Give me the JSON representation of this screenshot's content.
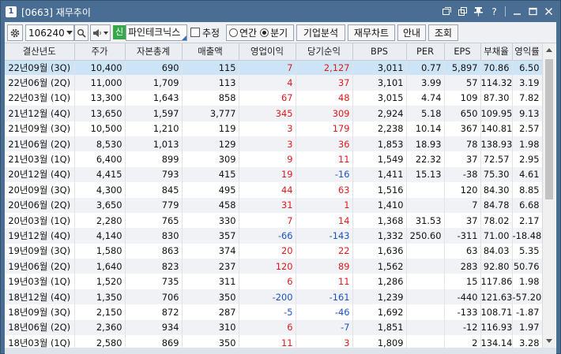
{
  "window": {
    "number": "1",
    "title": "[0663] 재무추이"
  },
  "titlebar_icons": [
    "restore-icon",
    "copy-icon",
    "pin-icon",
    "help-icon",
    "minimize-icon",
    "maximize-icon",
    "close-icon"
  ],
  "toolbar": {
    "stock_code": "106240",
    "new_badge": "신",
    "company_name": "파인테크닉스",
    "estimate_label": "추정",
    "estimate_checked": false,
    "period_options": [
      "연간",
      "분기"
    ],
    "period_selected": "분기",
    "buttons": [
      "기업분석",
      "재무차트",
      "안내",
      "조회"
    ]
  },
  "table": {
    "columns": [
      "결산년도",
      "주가",
      "자본총계",
      "매출액",
      "영업이익",
      "당기순익",
      "BPS",
      "PER",
      "EPS",
      "부채율",
      "영익률"
    ],
    "rows": [
      {
        "period": "22년09월 (3Q)",
        "price": "10,400",
        "equity": "690",
        "sales": "115",
        "op": "7",
        "net": "2,127",
        "bps": "3,011",
        "per": "0.77",
        "eps": "5,897",
        "debt": "70.86",
        "opm": "6.50",
        "op_c": "red",
        "net_c": "red"
      },
      {
        "period": "22년06월 (2Q)",
        "price": "11,000",
        "equity": "1,709",
        "sales": "113",
        "op": "4",
        "net": "37",
        "bps": "3,101",
        "per": "3.99",
        "eps": "57",
        "debt": "114.32",
        "opm": "3.19",
        "op_c": "red",
        "net_c": "red"
      },
      {
        "period": "22년03월 (1Q)",
        "price": "13,300",
        "equity": "1,643",
        "sales": "858",
        "op": "67",
        "net": "48",
        "bps": "3,015",
        "per": "4.74",
        "eps": "109",
        "debt": "87.30",
        "opm": "7.82",
        "op_c": "red",
        "net_c": "red"
      },
      {
        "period": "21년12월 (4Q)",
        "price": "13,650",
        "equity": "1,597",
        "sales": "3,777",
        "op": "345",
        "net": "309",
        "bps": "2,924",
        "per": "5.18",
        "eps": "650",
        "debt": "109.95",
        "opm": "9.13",
        "op_c": "red",
        "net_c": "red"
      },
      {
        "period": "21년09월 (3Q)",
        "price": "10,500",
        "equity": "1,210",
        "sales": "119",
        "op": "3",
        "net": "179",
        "bps": "2,238",
        "per": "10.14",
        "eps": "367",
        "debt": "140.81",
        "opm": "2.57",
        "op_c": "red",
        "net_c": "red"
      },
      {
        "period": "21년06월 (2Q)",
        "price": "8,530",
        "equity": "1,013",
        "sales": "129",
        "op": "3",
        "net": "36",
        "bps": "1,853",
        "per": "18.93",
        "eps": "78",
        "debt": "138.93",
        "opm": "1.98",
        "op_c": "red",
        "net_c": "red"
      },
      {
        "period": "21년03월 (1Q)",
        "price": "6,400",
        "equity": "899",
        "sales": "309",
        "op": "9",
        "net": "11",
        "bps": "1,549",
        "per": "22.32",
        "eps": "37",
        "debt": "72.57",
        "opm": "2.95",
        "op_c": "red",
        "net_c": "red"
      },
      {
        "period": "20년12월 (4Q)",
        "price": "4,415",
        "equity": "793",
        "sales": "415",
        "op": "19",
        "net": "-16",
        "bps": "1,411",
        "per": "15.13",
        "eps": "-38",
        "debt": "75.30",
        "opm": "4.61",
        "op_c": "red",
        "net_c": "blue"
      },
      {
        "period": "20년09월 (3Q)",
        "price": "4,300",
        "equity": "845",
        "sales": "495",
        "op": "44",
        "net": "63",
        "bps": "1,516",
        "per": "",
        "eps": "120",
        "debt": "84.30",
        "opm": "8.85",
        "op_c": "red",
        "net_c": "red"
      },
      {
        "period": "20년06월 (2Q)",
        "price": "3,650",
        "equity": "779",
        "sales": "458",
        "op": "31",
        "net": "1",
        "bps": "1,410",
        "per": "",
        "eps": "7",
        "debt": "84.78",
        "opm": "6.68",
        "op_c": "red",
        "net_c": "red"
      },
      {
        "period": "20년03월 (1Q)",
        "price": "2,280",
        "equity": "765",
        "sales": "330",
        "op": "7",
        "net": "14",
        "bps": "1,368",
        "per": "31.53",
        "eps": "37",
        "debt": "78.02",
        "opm": "2.17",
        "op_c": "red",
        "net_c": "red"
      },
      {
        "period": "19년12월 (4Q)",
        "price": "4,140",
        "equity": "830",
        "sales": "357",
        "op": "-66",
        "net": "-143",
        "bps": "1,332",
        "per": "250.60",
        "eps": "-311",
        "debt": "71.00",
        "opm": "-18.48",
        "op_c": "blue",
        "net_c": "blue"
      },
      {
        "period": "19년09월 (3Q)",
        "price": "1,580",
        "equity": "863",
        "sales": "374",
        "op": "20",
        "net": "22",
        "bps": "1,636",
        "per": "",
        "eps": "63",
        "debt": "84.03",
        "opm": "5.35",
        "op_c": "red",
        "net_c": "red"
      },
      {
        "period": "19년06월 (2Q)",
        "price": "1,640",
        "equity": "823",
        "sales": "237",
        "op": "120",
        "net": "89",
        "bps": "1,562",
        "per": "",
        "eps": "283",
        "debt": "92.80",
        "opm": "50.76",
        "op_c": "red",
        "net_c": "red"
      },
      {
        "period": "19년03월 (1Q)",
        "price": "1,520",
        "equity": "735",
        "sales": "311",
        "op": "6",
        "net": "11",
        "bps": "1,286",
        "per": "",
        "eps": "15",
        "debt": "117.86",
        "opm": "1.98",
        "op_c": "red",
        "net_c": "red"
      },
      {
        "period": "18년12월 (4Q)",
        "price": "1,350",
        "equity": "706",
        "sales": "350",
        "op": "-200",
        "net": "-161",
        "bps": "1,239",
        "per": "",
        "eps": "-440",
        "debt": "121.63",
        "opm": "-57.20",
        "op_c": "blue",
        "net_c": "blue"
      },
      {
        "period": "18년09월 (3Q)",
        "price": "2,150",
        "equity": "872",
        "sales": "287",
        "op": "-5",
        "net": "-46",
        "bps": "1,692",
        "per": "",
        "eps": "-133",
        "debt": "108.71",
        "opm": "-1.87",
        "op_c": "blue",
        "net_c": "blue"
      },
      {
        "period": "18년06월 (2Q)",
        "price": "2,360",
        "equity": "934",
        "sales": "310",
        "op": "6",
        "net": "-7",
        "bps": "1,851",
        "per": "",
        "eps": "-12",
        "debt": "116.93",
        "opm": "1.97",
        "op_c": "red",
        "net_c": "blue"
      },
      {
        "period": "18년03월 (1Q)",
        "price": "2,580",
        "equity": "869",
        "sales": "350",
        "op": "11",
        "net": "3",
        "bps": "1,809",
        "per": "",
        "eps": "2",
        "debt": "134.14",
        "opm": "3.28",
        "op_c": "red",
        "net_c": "red"
      }
    ],
    "selected_row": 0
  },
  "scrollbar": {
    "position_fraction": 0.0
  },
  "colors": {
    "titlebar": "#4a6d94",
    "positive": "#e0191d",
    "negative": "#1a52c4",
    "selected_row": "#cce4f5",
    "new_badge": "#36a84a"
  }
}
